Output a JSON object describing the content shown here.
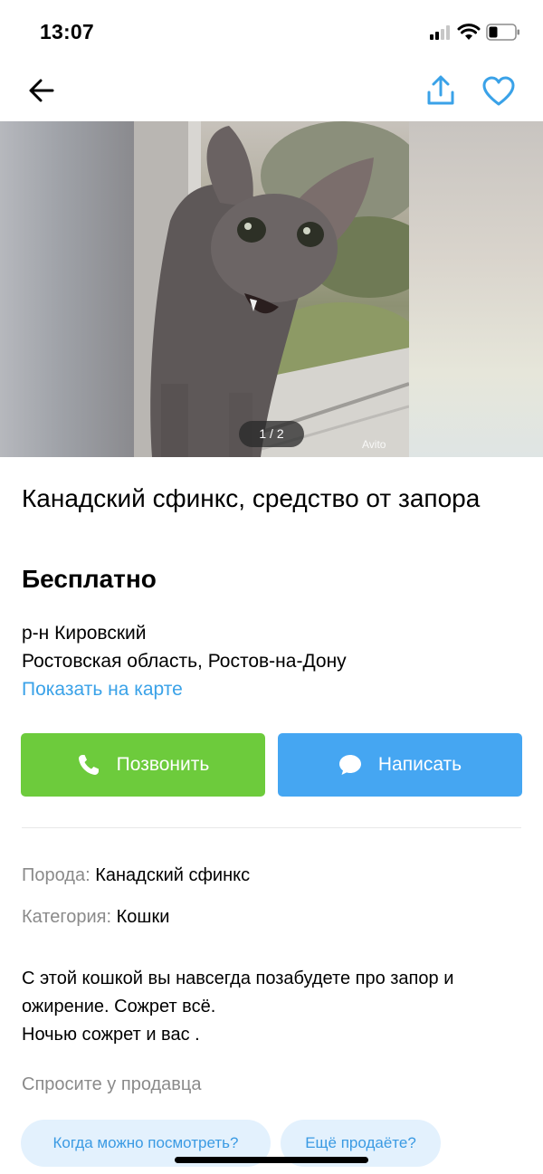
{
  "status_bar": {
    "time": "13:07"
  },
  "listing": {
    "title": "Канадский сфинкс, средство от запора",
    "price": "Бесплатно",
    "gallery": {
      "counter": "1 / 2",
      "watermark": "Avito"
    },
    "address": {
      "district": "р-н Кировский",
      "region_city": "Ростовская область, Ростов-на-Дону",
      "map_link": "Показать на карте"
    },
    "params": [
      {
        "label": "Порода:",
        "value": "Канадский сфинкс"
      },
      {
        "label": "Категория:",
        "value": "Кошки"
      }
    ],
    "description": [
      "С этой кошкой вы навсегда позабудете про запор и",
      "ожирение. Сожрет всё.",
      "Ночью сожрет и вас ."
    ]
  },
  "actions": {
    "call_label": "Позвонить",
    "write_label": "Написать"
  },
  "ask_seller": {
    "title": "Спросите у продавца",
    "chips": [
      "Когда можно посмотреть?",
      "Ещё продаёте?"
    ]
  },
  "colors": {
    "call": "#6dcb3c",
    "write": "#45a6f2",
    "link": "#3aa2e8",
    "chip_bg": "#e3f1fd"
  },
  "icons": {
    "back": "arrow-left-icon",
    "share": "share-icon",
    "favorite": "heart-icon",
    "call": "phone-icon",
    "write": "chat-bubble-icon"
  }
}
